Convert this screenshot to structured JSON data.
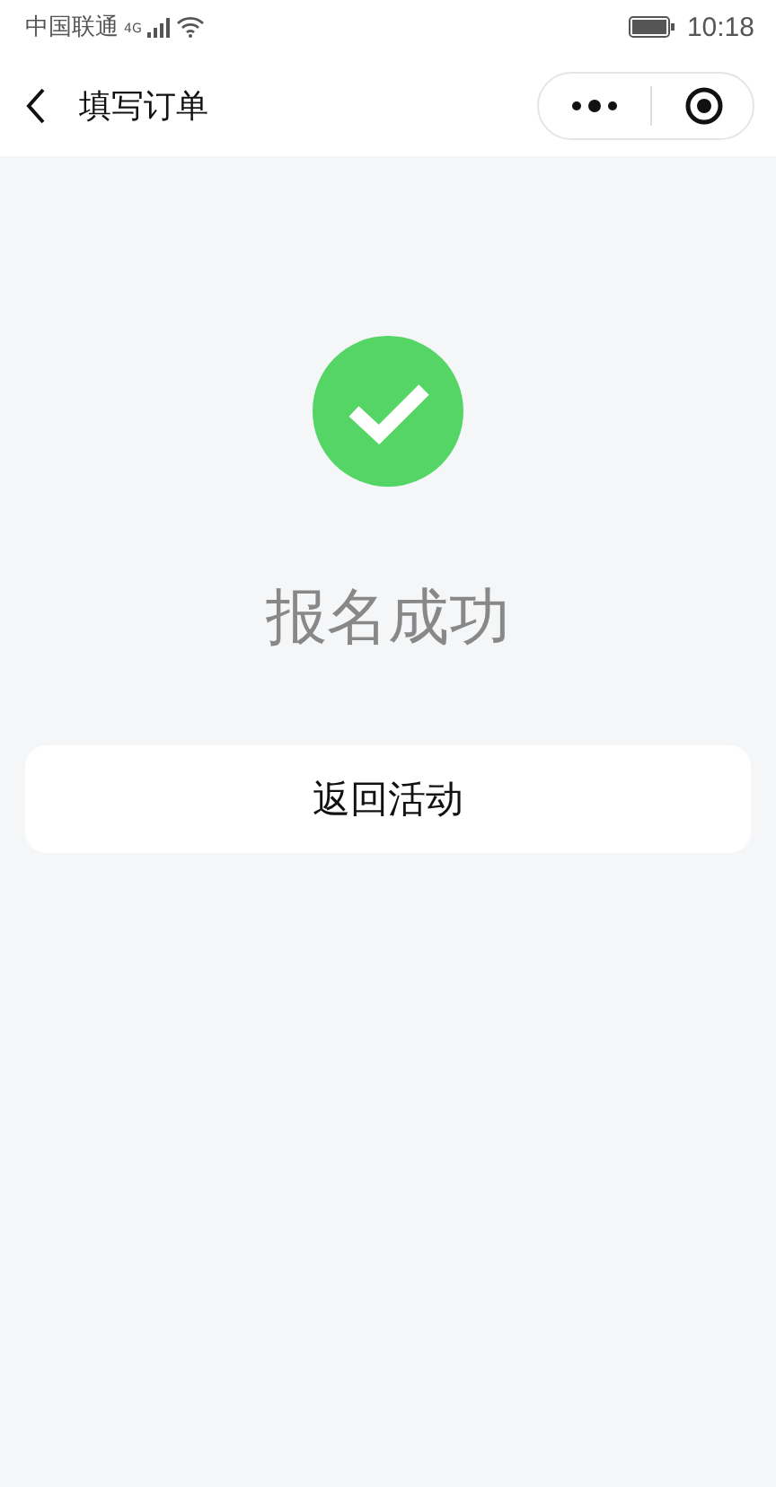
{
  "status_bar": {
    "carrier": "中国联通",
    "network": "4G",
    "time": "10:18"
  },
  "nav": {
    "title": "填写订单"
  },
  "result": {
    "title": "报名成功"
  },
  "buttons": [
    {
      "label": "返回活动"
    }
  ]
}
